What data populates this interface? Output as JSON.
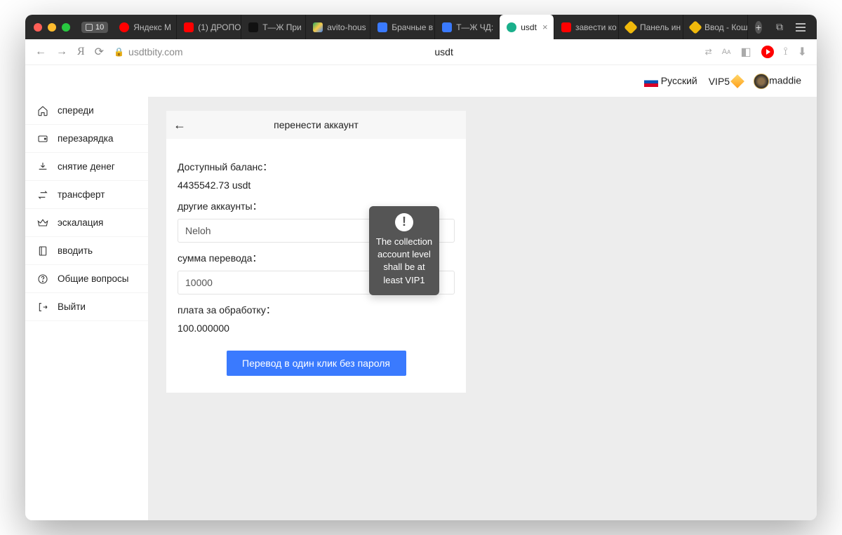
{
  "browser": {
    "tab_count": "10",
    "tabs": [
      {
        "label": "Яндекс М",
        "favicon_color": "#ff0000",
        "favicon_shape": "circle"
      },
      {
        "label": "(1) ДРОПО",
        "favicon_color": "#ff0000",
        "favicon_shape": "square"
      },
      {
        "label": "Т—Ж При",
        "favicon_color": "#111111",
        "favicon_shape": "square"
      },
      {
        "label": "avito-hous",
        "favicon_color": "#2aa860",
        "favicon_shape": "triangle"
      },
      {
        "label": "Брачные в",
        "favicon_color": "#3a7afe",
        "favicon_shape": "square"
      },
      {
        "label": "Т—Ж ЧД:",
        "favicon_color": "#3a7afe",
        "favicon_shape": "square"
      },
      {
        "label": "usdt",
        "favicon_color": "#1aaf8b",
        "favicon_shape": "circle",
        "active": true
      },
      {
        "label": "завести ко",
        "favicon_color": "#ff0000",
        "favicon_shape": "square"
      },
      {
        "label": "Панель ин",
        "favicon_color": "#f0b90b",
        "favicon_shape": "diamond"
      },
      {
        "label": "Ввод - Кош",
        "favicon_color": "#f0b90b",
        "favicon_shape": "diamond"
      }
    ],
    "url": "usdtbity.com",
    "page_title": "usdt"
  },
  "header": {
    "language": "Русский",
    "vip_label": "VIP5",
    "username": "maddie"
  },
  "sidebar": {
    "items": [
      {
        "label": "спереди",
        "icon": "home-icon"
      },
      {
        "label": "перезарядка",
        "icon": "wallet-icon"
      },
      {
        "label": "снятие денег",
        "icon": "withdraw-icon"
      },
      {
        "label": "трансферт",
        "icon": "transfer-icon"
      },
      {
        "label": "эскалация",
        "icon": "crown-icon"
      },
      {
        "label": "вводить",
        "icon": "book-icon"
      },
      {
        "label": "Общие вопросы",
        "icon": "help-icon"
      },
      {
        "label": "Выйти",
        "icon": "logout-icon"
      }
    ]
  },
  "transfer": {
    "title": "перенести аккаунт",
    "balance_label": "Доступный баланс：",
    "balance_value": "4435542.73 usdt",
    "account_label": "другие аккаунты：",
    "account_value": "Neloh",
    "amount_label": "сумма перевода：",
    "amount_value": "10000",
    "fee_label": "плата за обработку：",
    "fee_value": "100.000000",
    "submit_label": "Перевод в один клик без пароля"
  },
  "toast": {
    "message": "The collection account level shall be at least VIP1"
  }
}
